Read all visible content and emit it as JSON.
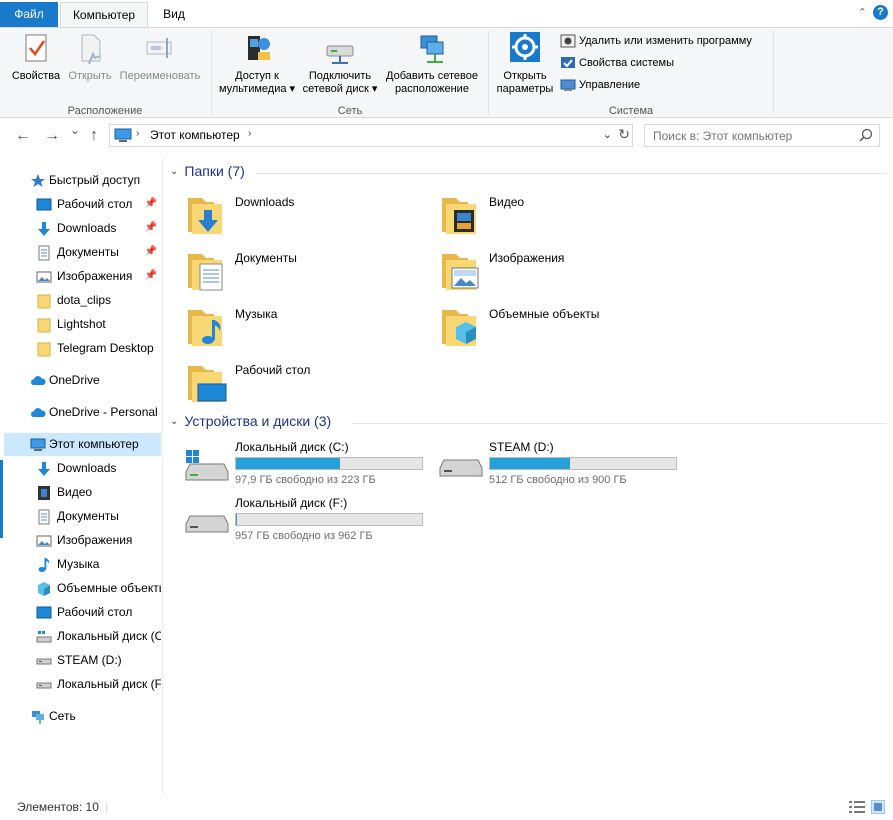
{
  "ribbon_tabs": {
    "file": "Файл",
    "computer": "Компьютер",
    "view": "Вид"
  },
  "help": "?",
  "collapse": "⌃",
  "ribbon": {
    "location": {
      "label": "Расположение",
      "properties": "Свойства",
      "open": "Открыть",
      "rename": "Переименовать"
    },
    "network": {
      "label": "Сеть",
      "media_line1": "Доступ к",
      "media_line2": "мультимедиа ▾",
      "map_line1": "Подключить",
      "map_line2": "сетевой диск ▾",
      "add_line1": "Добавить сетевое",
      "add_line2": "расположение"
    },
    "system": {
      "label": "Система",
      "settings_line1": "Открыть",
      "settings_line2": "параметры",
      "uninstall": "Удалить или изменить программу",
      "sysprops": "Свойства системы",
      "manage": "Управление"
    }
  },
  "nav": {
    "back": "←",
    "forward": "→",
    "recent": "⌄",
    "up": "↑",
    "breadcrumb_sep": "›",
    "address": "Этот компьютер",
    "address_dropdown": "⌄",
    "refresh": "↻",
    "search_placeholder": "Поиск в: Этот компьютер"
  },
  "sidebar": {
    "quick_access": "Быстрый доступ",
    "quick_items": [
      {
        "label": "Рабочий стол",
        "pinned": true
      },
      {
        "label": "Downloads",
        "pinned": true
      },
      {
        "label": "Документы",
        "pinned": true
      },
      {
        "label": "Изображения",
        "pinned": true
      },
      {
        "label": "dota_clips",
        "pinned": false
      },
      {
        "label": "Lightshot",
        "pinned": false
      },
      {
        "label": "Telegram Desktop",
        "pinned": false
      }
    ],
    "onedrive": "OneDrive",
    "onedrive_personal": "OneDrive - Personal",
    "this_pc": "Этот компьютер",
    "pc_items": [
      "Downloads",
      "Видео",
      "Документы",
      "Изображения",
      "Музыка",
      "Объемные объекты",
      "Рабочий стол",
      "Локальный диск (C:)",
      "STEAM (D:)",
      "Локальный диск (F:)"
    ],
    "network": "Сеть"
  },
  "folders_section": "Папки (7)",
  "folders": [
    "Downloads",
    "Видео",
    "Документы",
    "Изображения",
    "Музыка",
    "Объемные объекты",
    "Рабочий стол"
  ],
  "drives_section": "Устройства и диски (3)",
  "drives": [
    {
      "name": "Локальный диск (C:)",
      "free": "97,9 ГБ свободно из 223 ГБ",
      "used_fraction": 0.56
    },
    {
      "name": "STEAM (D:)",
      "free": "512 ГБ свободно из 900 ГБ",
      "used_fraction": 0.43
    },
    {
      "name": "Локальный диск (F:)",
      "free": "957 ГБ свободно из 962 ГБ",
      "used_fraction": 0.005
    }
  ],
  "status": {
    "count": "Элементов: 10"
  },
  "colors": {
    "accent": "#1979ca",
    "selected": "#cce8ff",
    "drive_bar": "#26a0da",
    "folder": "#f8d775"
  }
}
